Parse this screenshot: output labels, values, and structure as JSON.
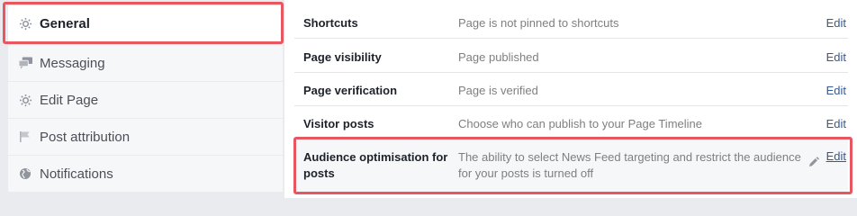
{
  "sidebar": {
    "items": [
      {
        "label": "General",
        "icon": "gear-icon",
        "active": true
      },
      {
        "label": "Messaging",
        "icon": "messaging-icon",
        "active": false
      },
      {
        "label": "Edit Page",
        "icon": "gear-icon",
        "active": false
      },
      {
        "label": "Post attribution",
        "icon": "flag-icon",
        "active": false
      },
      {
        "label": "Notifications",
        "icon": "globe-icon",
        "active": false
      }
    ]
  },
  "settings": {
    "rows": [
      {
        "label": "Shortcuts",
        "value": "Page is not pinned to shortcuts",
        "action": "Edit"
      },
      {
        "label": "Page visibility",
        "value": "Page published",
        "action": "Edit"
      },
      {
        "label": "Page verification",
        "value": "Page is verified",
        "action": "Edit"
      },
      {
        "label": "Visitor posts",
        "value": "Choose who can publish to your Page Timeline",
        "action": "Edit"
      },
      {
        "label": "Audience optimisation for posts",
        "value": "The ability to select News Feed targeting and restrict the audience for your posts is turned off",
        "action": "Edit"
      }
    ]
  },
  "colors": {
    "highlight": "#e8575f",
    "link": "#365899"
  }
}
